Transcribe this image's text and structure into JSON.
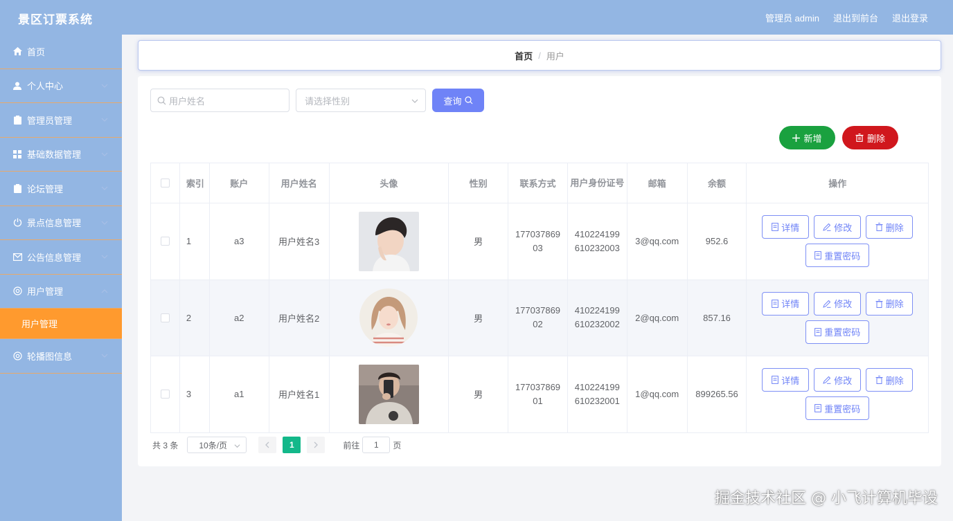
{
  "header": {
    "brand": "景区订票系统",
    "links": [
      "管理员 admin",
      "退出到前台",
      "退出登录"
    ]
  },
  "sidebar": {
    "items": [
      {
        "label": "首页",
        "icon": "home-icon"
      },
      {
        "label": "个人中心",
        "icon": "user-icon"
      },
      {
        "label": "管理员管理",
        "icon": "clipboard-icon"
      },
      {
        "label": "基础数据管理",
        "icon": "grid-icon"
      },
      {
        "label": "论坛管理",
        "icon": "clipboard-icon"
      },
      {
        "label": "景点信息管理",
        "icon": "power-icon"
      },
      {
        "label": "公告信息管理",
        "icon": "mail-icon"
      },
      {
        "label": "用户管理",
        "icon": "settings-icon"
      },
      {
        "label": "轮播图信息",
        "icon": "settings-icon"
      }
    ],
    "active_sub": "用户管理"
  },
  "breadcrumb": {
    "home": "首页",
    "sep": "/",
    "current": "用户"
  },
  "search": {
    "name_placeholder": "用户姓名",
    "gender_placeholder": "请选择性别",
    "query_label": "查询"
  },
  "actions": {
    "add_label": "新增",
    "delete_label": "删除"
  },
  "table": {
    "headers": [
      "索引",
      "账户",
      "用户姓名",
      "头像",
      "性别",
      "联系方式",
      "用户身份证号",
      "邮箱",
      "余额",
      "操作"
    ],
    "rows": [
      {
        "index": "1",
        "account": "a3",
        "name": "用户姓名3",
        "gender": "男",
        "phone_1": "177037869",
        "phone_2": "03",
        "id_1": "410224199",
        "id_2": "610232003",
        "email": "3@qq.com",
        "balance": "952.6"
      },
      {
        "index": "2",
        "account": "a2",
        "name": "用户姓名2",
        "gender": "男",
        "phone_1": "177037869",
        "phone_2": "02",
        "id_1": "410224199",
        "id_2": "610232002",
        "email": "2@qq.com",
        "balance": "857.16"
      },
      {
        "index": "3",
        "account": "a1",
        "name": "用户姓名1",
        "gender": "男",
        "phone_1": "177037869",
        "phone_2": "01",
        "id_1": "410224199",
        "id_2": "610232001",
        "email": "1@qq.com",
        "balance": "899265.56"
      }
    ],
    "ops": {
      "detail": "详情",
      "edit": "修改",
      "delete": "删除",
      "reset": "重置密码"
    }
  },
  "pagination": {
    "total": "共 3 条",
    "page_size": "10条/页",
    "current": "1",
    "goto": "前往",
    "goto_value": "1",
    "page_unit": "页"
  },
  "watermark": "掘金技术社区 @ 小飞计算机毕设",
  "colors": {
    "topbar": "#93b6e3",
    "sidebar": "#93b6e3",
    "active_sub": "#ff9a2e",
    "primary": "#6f83f7",
    "success": "#1aa13f",
    "danger": "#d0171d",
    "pager_active": "#13b88a"
  }
}
